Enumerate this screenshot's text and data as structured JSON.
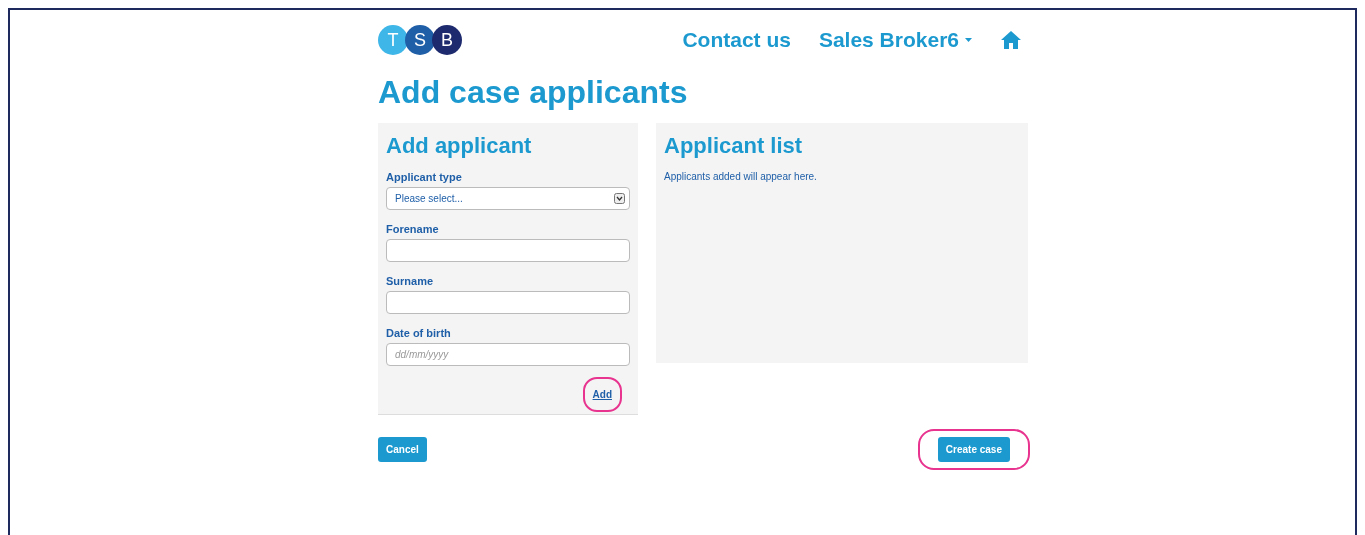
{
  "header": {
    "logo_letters": [
      "T",
      "S",
      "B"
    ],
    "nav": [
      {
        "label": "Contact us",
        "kind": "link"
      },
      {
        "label": "Sales Broker6",
        "kind": "dropdown"
      },
      {
        "kind": "home"
      }
    ]
  },
  "page_title": "Add case applicants",
  "add_panel": {
    "title": "Add applicant",
    "fields": [
      {
        "label": "Applicant type",
        "kind": "select",
        "value": "Please select..."
      },
      {
        "label": "Forename",
        "kind": "text"
      },
      {
        "label": "Surname",
        "kind": "text"
      },
      {
        "label": "Date of birth",
        "kind": "date",
        "placeholder": "dd/mm/yyyy"
      }
    ],
    "add_link": {
      "label": "Add",
      "highlighted": true
    }
  },
  "list_panel": {
    "title": "Applicant list",
    "empty_text": "Applicants added will appear here."
  },
  "buttons": [
    {
      "label": "Cancel",
      "highlighted": false
    },
    {
      "label": "Create case",
      "highlighted": true
    }
  ]
}
